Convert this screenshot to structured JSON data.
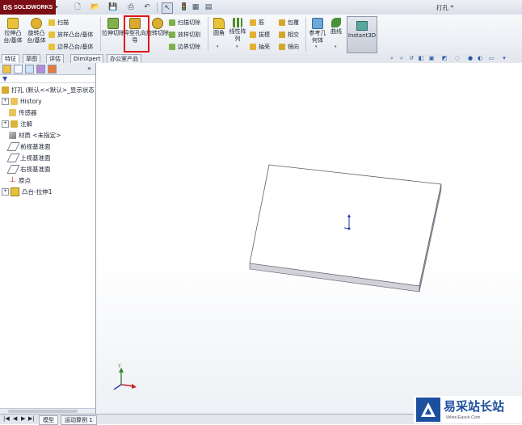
{
  "app": {
    "brand": "SOLIDWORKS",
    "document_title": "打孔 *"
  },
  "toolbar": {
    "extrude_boss": "拉伸凸台/基体",
    "revolve_boss": "旋转凸台/基体",
    "sweep": "扫描",
    "loft": "放样凸台/基体",
    "boundary_boss": "边界凸台/基体",
    "extrude_cut": "拉伸切除",
    "hole_wizard": "异型孔向导",
    "revolve_cut": "旋转切除",
    "sweep_cut": "扫描切除",
    "loft_cut": "放样切割",
    "boundary_cut": "边界切除",
    "fillet": "圆角",
    "linear_pattern": "线性阵列",
    "rib": "筋",
    "draft": "拔模",
    "shell": "抽壳",
    "wrap": "包覆",
    "intersect": "相交",
    "mirror": "镜向",
    "reference_geometry": "参考几何体",
    "curves": "曲线",
    "instant3d": "Instant3D"
  },
  "tabs": [
    "特征",
    "草图",
    "评估",
    "DimXpert",
    "办公室产品"
  ],
  "feature_tree": {
    "root": "打孔 (默认<<默认>_显示状态",
    "items": [
      "History",
      "传感器",
      "注解",
      "材质 <未指定>",
      "前视基准面",
      "上视基准面",
      "右视基准面",
      "原点",
      "凸台-拉伸1"
    ]
  },
  "bottom_tabs": [
    "模型",
    "运动算例 1"
  ],
  "watermark": {
    "name": "易采站长站",
    "url": "Www.Easck.Com"
  },
  "colors": {
    "highlight": "#e0161c",
    "brand": "#7a0e14",
    "watermark": "#1d4f9f"
  }
}
